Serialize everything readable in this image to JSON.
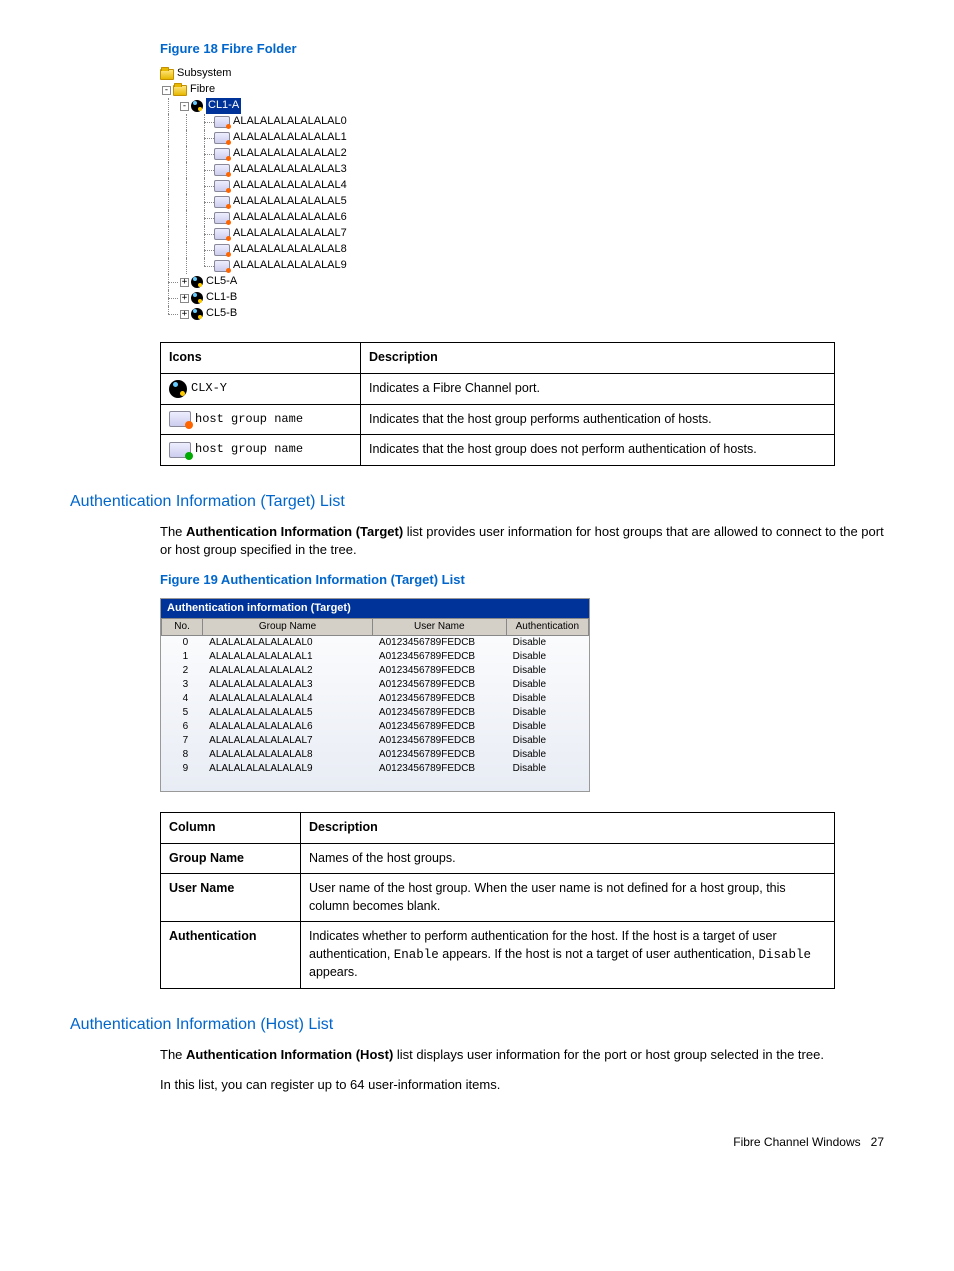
{
  "figure18": {
    "caption": "Figure 18  Fibre Folder",
    "tree": {
      "root": "Subsystem",
      "fibre": "Fibre",
      "selected_port": "CL1-A",
      "host_items": [
        "ALALALALALALALAL0",
        "ALALALALALALALAL1",
        "ALALALALALALALAL2",
        "ALALALALALALALAL3",
        "ALALALALALALALAL4",
        "ALALALALALALALAL5",
        "ALALALALALALALAL6",
        "ALALALALALALALAL7",
        "ALALALALALALALAL8",
        "ALALALALALALALAL9"
      ],
      "collapsed_ports": [
        "CL5-A",
        "CL1-B",
        "CL5-B"
      ]
    }
  },
  "icon_table": {
    "headers": [
      "Icons",
      "Description"
    ],
    "rows": [
      {
        "label": "CLX-Y",
        "desc": "Indicates a Fibre Channel port."
      },
      {
        "label": "host group name",
        "desc": "Indicates that the host group performs authentication of hosts."
      },
      {
        "label": "host group name",
        "desc": "Indicates that the host group does not perform authentication of hosts."
      }
    ]
  },
  "section_target": {
    "heading": "Authentication Information (Target) List",
    "body_prefix": "The ",
    "body_bold": "Authentication Information (Target)",
    "body_suffix": " list provides user information for host groups that are allowed to connect to the port or host group specified in the tree."
  },
  "figure19": {
    "caption": "Figure 19 Authentication Information (Target) List",
    "panel_title": "Authentication information (Target)",
    "headers": [
      "No.",
      "Group Name",
      "User Name",
      "Authentication"
    ],
    "rows": [
      {
        "no": "0",
        "group": "ALALALALALALALAL0",
        "user": "A0123456789FEDCB",
        "auth": "Disable"
      },
      {
        "no": "1",
        "group": "ALALALALALALALAL1",
        "user": "A0123456789FEDCB",
        "auth": "Disable"
      },
      {
        "no": "2",
        "group": "ALALALALALALALAL2",
        "user": "A0123456789FEDCB",
        "auth": "Disable"
      },
      {
        "no": "3",
        "group": "ALALALALALALALAL3",
        "user": "A0123456789FEDCB",
        "auth": "Disable"
      },
      {
        "no": "4",
        "group": "ALALALALALALALAL4",
        "user": "A0123456789FEDCB",
        "auth": "Disable"
      },
      {
        "no": "5",
        "group": "ALALALALALALALAL5",
        "user": "A0123456789FEDCB",
        "auth": "Disable"
      },
      {
        "no": "6",
        "group": "ALALALALALALALAL6",
        "user": "A0123456789FEDCB",
        "auth": "Disable"
      },
      {
        "no": "7",
        "group": "ALALALALALALALAL7",
        "user": "A0123456789FEDCB",
        "auth": "Disable"
      },
      {
        "no": "8",
        "group": "ALALALALALALALAL8",
        "user": "A0123456789FEDCB",
        "auth": "Disable"
      },
      {
        "no": "9",
        "group": "ALALALALALALALAL9",
        "user": "A0123456789FEDCB",
        "auth": "Disable"
      }
    ]
  },
  "column_table": {
    "headers": [
      "Column",
      "Description"
    ],
    "rows": [
      {
        "col": "Group Name",
        "desc": "Names of the host groups."
      },
      {
        "col": "User Name",
        "desc": "User name of the host group. When the user name is not defined for a host group, this column becomes blank."
      },
      {
        "col": "Authentication",
        "desc_pre": "Indicates whether to perform authentication for the host. If the host is a target of user authentication, ",
        "code1": "Enable",
        "desc_mid": " appears. If the host is not a target of user authentication, ",
        "code2": "Disable",
        "desc_post": " appears."
      }
    ]
  },
  "section_host": {
    "heading": "Authentication Information (Host) List",
    "body1_prefix": "The ",
    "body1_bold": "Authentication Information (Host)",
    "body1_suffix": " list displays user information for the port or host group selected in the tree.",
    "body2": "In this list, you can register up to 64 user-information items."
  },
  "footer": {
    "text": "Fibre Channel Windows",
    "page": "27"
  }
}
